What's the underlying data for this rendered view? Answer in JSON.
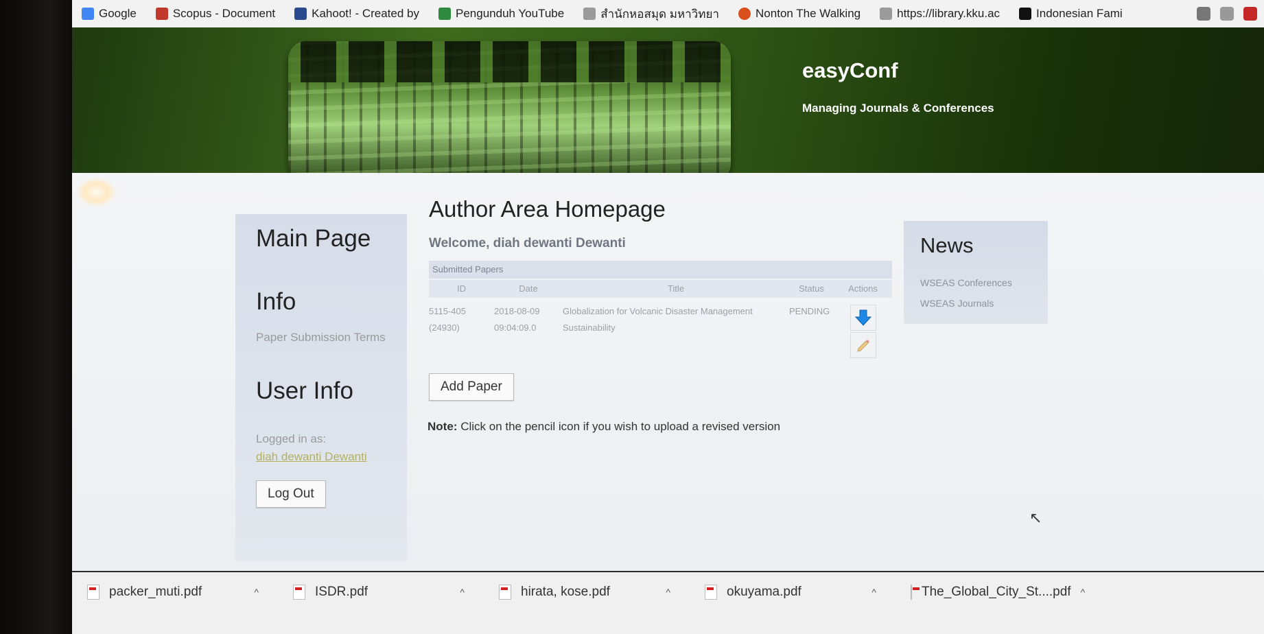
{
  "bookmarks": [
    {
      "label": "Google",
      "color": "#4285f4"
    },
    {
      "label": "Scopus - Document",
      "color": "#e9711c"
    },
    {
      "label": "Kahoot! - Created by",
      "color": "#46178f"
    },
    {
      "label": "Pengunduh YouTube",
      "color": "#2e8b3d"
    },
    {
      "label": "สำนักหอสมุด มหาวิทยา",
      "color": "#8b8b8b"
    },
    {
      "label": "Nonton The Walking",
      "color": "#d94f1e"
    },
    {
      "label": "https://library.kku.ac",
      "color": "#8b8b8b"
    },
    {
      "label": "Indonesian Fami",
      "color": "#111111"
    }
  ],
  "header": {
    "title": "easyConf",
    "subtitle": "Managing Journals & Conferences"
  },
  "left_panel": {
    "main_page": "Main Page",
    "info_heading": "Info",
    "info_link": "Paper Submission Terms",
    "user_heading": "User Info",
    "logged_in_label": "Logged in as:",
    "user_name": "diah dewanti Dewanti",
    "logout_label": "Log Out"
  },
  "main": {
    "title": "Author Area Homepage",
    "welcome": "Welcome, diah dewanti Dewanti",
    "table_caption": "Submitted Papers",
    "columns": [
      "ID",
      "Date",
      "Title",
      "Status",
      "Actions"
    ],
    "rows": [
      {
        "id_line1": "5115-405",
        "id_line2": "(24930)",
        "date_line1": "2018-08-09",
        "date_line2": "09:04:09.0",
        "title": "Globalization for Volcanic Disaster Management Sustainability",
        "status": "PENDING"
      }
    ],
    "add_paper_label": "Add Paper",
    "note_label": "Note:",
    "note_text": "Click on the pencil icon if you wish to upload a revised version"
  },
  "news": {
    "heading": "News",
    "items": [
      "WSEAS Conferences",
      "WSEAS Journals"
    ]
  },
  "downloads": [
    "packer_muti.pdf",
    "ISDR.pdf",
    "hirata, kose.pdf",
    "okuyama.pdf",
    "The_Global_City_St....pdf"
  ],
  "colors": {
    "banner_green": "#3f6b1e",
    "user_link": "#b3b063",
    "download_arrow": "#1e88e5"
  }
}
